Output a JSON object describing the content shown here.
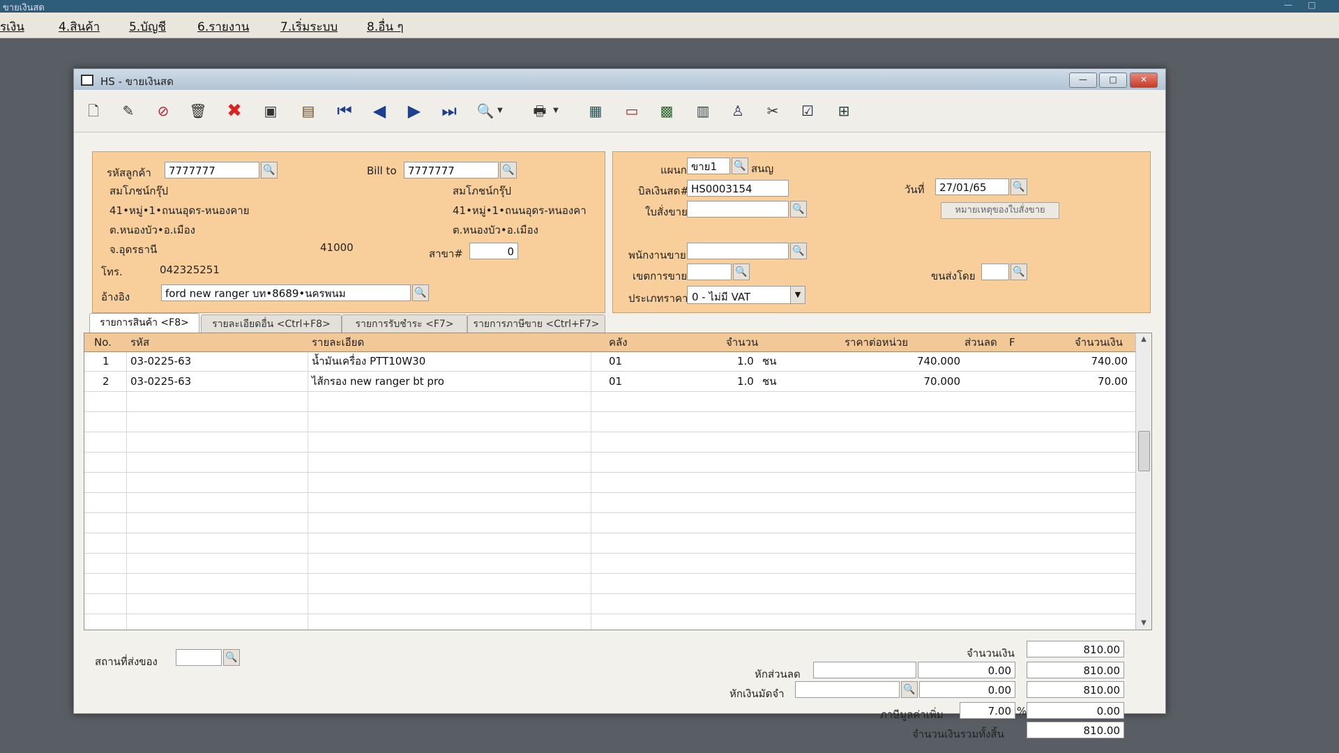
{
  "taskbar": {
    "title": "ขายเงินสด"
  },
  "menu": [
    "รเงิน",
    "4.สินค้า",
    "5.บัญชี",
    "6.รายงาน",
    "7.เริ่มระบบ",
    "8.อื่น ๆ"
  ],
  "window": {
    "title": "HS - ขายเงินสด",
    "minimize": "—",
    "maximize": "□",
    "close": "✕"
  },
  "customer": {
    "code_label": "รหัสลูกค้า",
    "code": "7777777",
    "name": "สมโภชน์กรุ๊ป",
    "addr1": "41•หมู่•1•ถนนอุดร-หนองคาย",
    "addr2": "ต.หนองบัว•อ.เมือง",
    "province": "จ.อุดรธานี",
    "postcode": "41000",
    "phone_label": "โทร.",
    "phone": "042325251",
    "ref_label": "อ้างอิง",
    "ref": "ford new ranger บท•8689•นครพนม"
  },
  "billto": {
    "label": "Bill to",
    "code": "7777777",
    "name": "สมโภชน์กรุ๊ป",
    "addr1": "41•หมู่•1•ถนนอุดร-หนองคา",
    "addr2": "ต.หนองบัว•อ.เมือง",
    "branch_label": "สาขา#",
    "branch": "0"
  },
  "doc": {
    "dept_label": "แผนก",
    "dept": "ขาย1",
    "dept_name": "สนญ",
    "bill_label": "บิลเงินสด#",
    "bill": "HS0003154",
    "date_label": "วันที่",
    "date": "27/01/65",
    "order_label": "ใบสั่งขาย",
    "order": "",
    "note_button": "หมายเหตุของใบสั่งขาย",
    "salesman_label": "พนักงานขาย",
    "salesman": "",
    "area_label": "เขตการขาย",
    "area": "",
    "ship_label": "ขนส่งโดย",
    "ship": "",
    "pricetype_label": "ประเภทราคา",
    "pricetype": "0 - ไม่มี VAT"
  },
  "tabs": [
    "รายการสินค้า <F8>",
    "รายละเอียดอื่น <Ctrl+F8>",
    "รายการรับชำระ <F7>",
    "รายการภาษีขาย <Ctrl+F7>"
  ],
  "grid": {
    "headers": [
      "No.",
      "รหัส",
      "รายละเอียด",
      "คลัง",
      "จำนวน",
      "ราคาต่อหน่วย",
      "ส่วนลด",
      "F",
      "จำนวนเงิน"
    ],
    "rows": [
      {
        "no": "1",
        "code": "03-0225-63",
        "desc": "น้ำมันเครื่อง PTT10W30",
        "wh": "01",
        "qty": "1.0",
        "unit": "ชน",
        "price": "740.000",
        "disc": "",
        "f": "",
        "amount": "740.00"
      },
      {
        "no": "2",
        "code": "03-0225-63",
        "desc": "ไส้กรอง new ranger bt pro",
        "wh": "01",
        "qty": "1.0",
        "unit": "ชน",
        "price": "70.000",
        "disc": "",
        "f": "",
        "amount": "70.00"
      }
    ]
  },
  "footer": {
    "delivery_label": "สถานที่ส่งของ",
    "delivery": "",
    "amount_label": "จำนวนเงิน",
    "amount": "810.00",
    "discount_label": "หักส่วนลด",
    "discount_text": "",
    "discount_value": "0.00",
    "after_discount": "810.00",
    "deposit_label": "หักเงินมัดจำ",
    "deposit_text": "",
    "deposit_value": "0.00",
    "after_deposit": "810.00",
    "vat_label": "ภาษีมูลค่าเพิ่ม",
    "vat_rate": "7.00",
    "vat_pct": "%",
    "vat_amount": "0.00",
    "total_label": "จำนวนเงินรวมทั้งสิ้น",
    "total": "810.00"
  }
}
